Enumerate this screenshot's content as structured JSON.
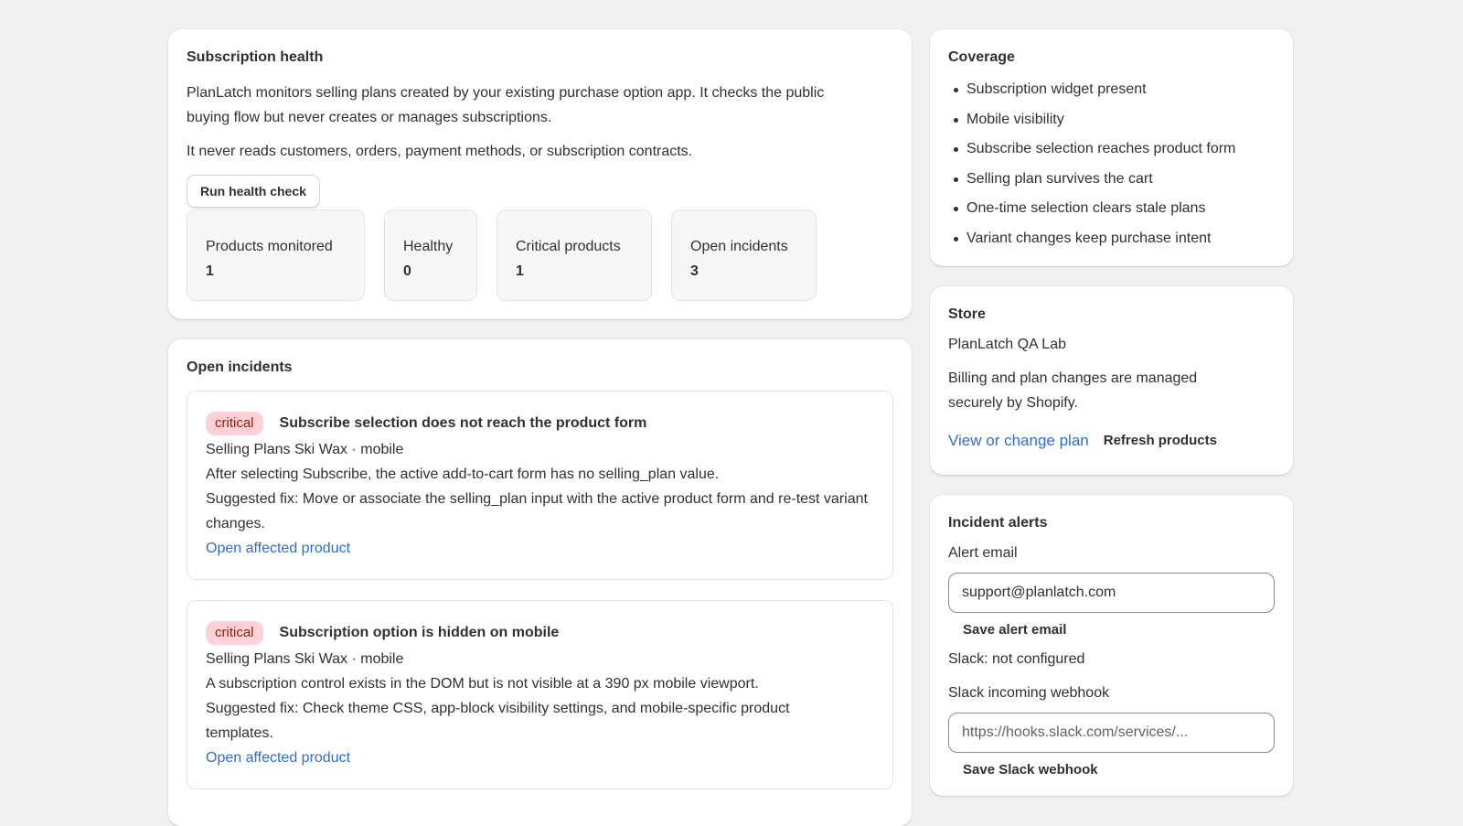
{
  "health": {
    "title": "Subscription health",
    "desc1": "PlanLatch monitors selling plans created by your existing purchase option app. It checks the public buying flow but never creates or manages subscriptions.",
    "desc2": "It never reads customers, orders, payment methods, or subscription contracts.",
    "run_button": "Run health check",
    "metrics": [
      {
        "label": "Products monitored",
        "value": "1"
      },
      {
        "label": "Healthy",
        "value": "0"
      },
      {
        "label": "Critical products",
        "value": "1"
      },
      {
        "label": "Open incidents",
        "value": "3"
      }
    ]
  },
  "incidents": {
    "title": "Open incidents",
    "items": [
      {
        "severity": "critical",
        "title": "Subscribe selection does not reach the product form",
        "meta": "Selling Plans Ski Wax · mobile",
        "detail": "After selecting Subscribe, the active add-to-cart form has no selling_plan value.",
        "fix": "Suggested fix: Move or associate the selling_plan input with the active product form and re-test variant changes.",
        "link": "Open affected product"
      },
      {
        "severity": "critical",
        "title": "Subscription option is hidden on mobile",
        "meta": "Selling Plans Ski Wax · mobile",
        "detail": "A subscription control exists in the DOM but is not visible at a 390 px mobile viewport.",
        "fix": "Suggested fix: Check theme CSS, app-block visibility settings, and mobile-specific product templates.",
        "link": "Open affected product"
      }
    ]
  },
  "coverage": {
    "title": "Coverage",
    "items": [
      "Subscription widget present",
      "Mobile visibility",
      "Subscribe selection reaches product form",
      "Selling plan survives the cart",
      "One-time selection clears stale plans",
      "Variant changes keep purchase intent"
    ]
  },
  "store": {
    "title": "Store",
    "name": "PlanLatch QA Lab",
    "billing_note": "Billing and plan changes are managed securely by Shopify.",
    "plan_link": "View or change plan",
    "refresh_button": "Refresh products"
  },
  "alerts": {
    "title": "Incident alerts",
    "email_label": "Alert email",
    "email_value": "support@planlatch.com",
    "save_email": "Save alert email",
    "slack_status": "Slack: not configured",
    "webhook_label": "Slack incoming webhook",
    "webhook_placeholder": "https://hooks.slack.com/services/...",
    "save_webhook": "Save Slack webhook"
  },
  "colors": {
    "background": "#f1f1f1",
    "link": "#2c6ecb",
    "critical_badge_bg": "#fed1d7",
    "critical_badge_text": "#8e1f0b"
  }
}
